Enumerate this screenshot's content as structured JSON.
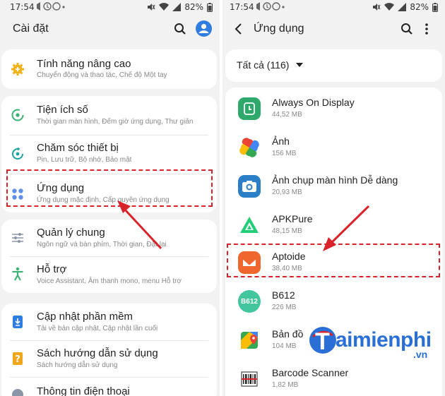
{
  "left": {
    "status": {
      "time": "17:54",
      "battery": "82%"
    },
    "title": "Cài đặt",
    "items": [
      {
        "label": "Tính năng nâng cao",
        "sub": "Chuyển động và thao tác, Chế độ Một tay"
      },
      {
        "label": "Tiện ích số",
        "sub": "Thời gian màn hình, Đếm giờ ứng dụng, Thư giãn"
      },
      {
        "label": "Chăm sóc thiết bị",
        "sub": "Pin, Lưu trữ, Bộ nhớ, Bảo mật"
      },
      {
        "label": "Ứng dụng",
        "sub": "Ứng dụng mặc định, Cấp quyền ứng dụng"
      },
      {
        "label": "Quản lý chung",
        "sub": "Ngôn ngữ và bàn phím, Thời gian, Đặt lại"
      },
      {
        "label": "Hỗ trợ",
        "sub": "Voice Assistant, Âm thanh mono, menu Hỗ trợ"
      },
      {
        "label": "Cập nhật phần mềm",
        "sub": "Tải về bản cập nhật, Cập nhật lần cuối"
      },
      {
        "label": "Sách hướng dẫn sử dụng",
        "sub": "Sách hướng dẫn sử dụng"
      },
      {
        "label": "Thông tin điện thoại",
        "sub": ""
      }
    ]
  },
  "right": {
    "status": {
      "time": "17:54",
      "battery": "82%"
    },
    "title": "Ứng dụng",
    "filter": "Tất cả (116)",
    "apps": [
      {
        "name": "Always On Display",
        "size": "44,52 MB"
      },
      {
        "name": "Ảnh",
        "size": "156 MB"
      },
      {
        "name": "Ảnh chụp màn hình Dễ dàng",
        "size": "20,93 MB"
      },
      {
        "name": "APKPure",
        "size": "48,15 MB"
      },
      {
        "name": "Aptoide",
        "size": "38,40 MB"
      },
      {
        "name": "B612",
        "size": "226 MB"
      },
      {
        "name": "Bản đồ",
        "size": "104 MB"
      },
      {
        "name": "Barcode Scanner",
        "size": "1,82 MB"
      }
    ],
    "b612_icon_text": "B612"
  },
  "watermark": {
    "brand": "aimienphi",
    "initial": "T",
    "suffix": ".vn"
  },
  "colors": {
    "highlight": "#d8232a",
    "icon_blue": "#2f7de1",
    "accent": "#3a6fd8"
  }
}
